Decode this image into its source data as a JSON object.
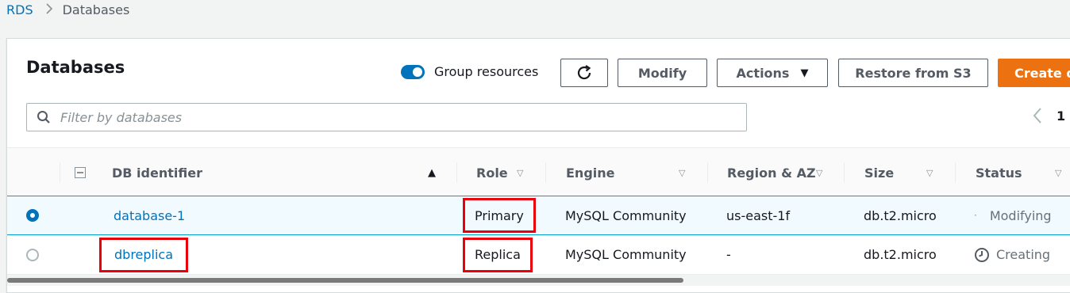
{
  "breadcrumb": {
    "root": "RDS",
    "current": "Databases"
  },
  "panel": {
    "title": "Databases",
    "group_resources_label": "Group resources",
    "group_resources_on": true,
    "buttons": {
      "modify": "Modify",
      "actions": "Actions",
      "restore": "Restore from S3",
      "create": "Create d"
    },
    "search": {
      "placeholder": "Filter by databases",
      "value": ""
    },
    "pagination": {
      "page": "1"
    }
  },
  "table": {
    "columns": {
      "identifier": "DB identifier",
      "role": "Role",
      "engine": "Engine",
      "region": "Region & AZ",
      "size": "Size",
      "status": "Status"
    },
    "rows": [
      {
        "identifier": "database-1",
        "role": "Primary",
        "engine": "MySQL Community",
        "region": "us-east-1f",
        "size": "db.t2.micro",
        "status": "Modifying",
        "selected": true
      },
      {
        "identifier": "dbreplica",
        "role": "Replica",
        "engine": "MySQL Community",
        "region": "-",
        "size": "db.t2.micro",
        "status": "Creating",
        "selected": false
      }
    ]
  },
  "colors": {
    "accent": "#0073bb",
    "primary_button": "#ec7211",
    "highlight": "#e8000b"
  }
}
